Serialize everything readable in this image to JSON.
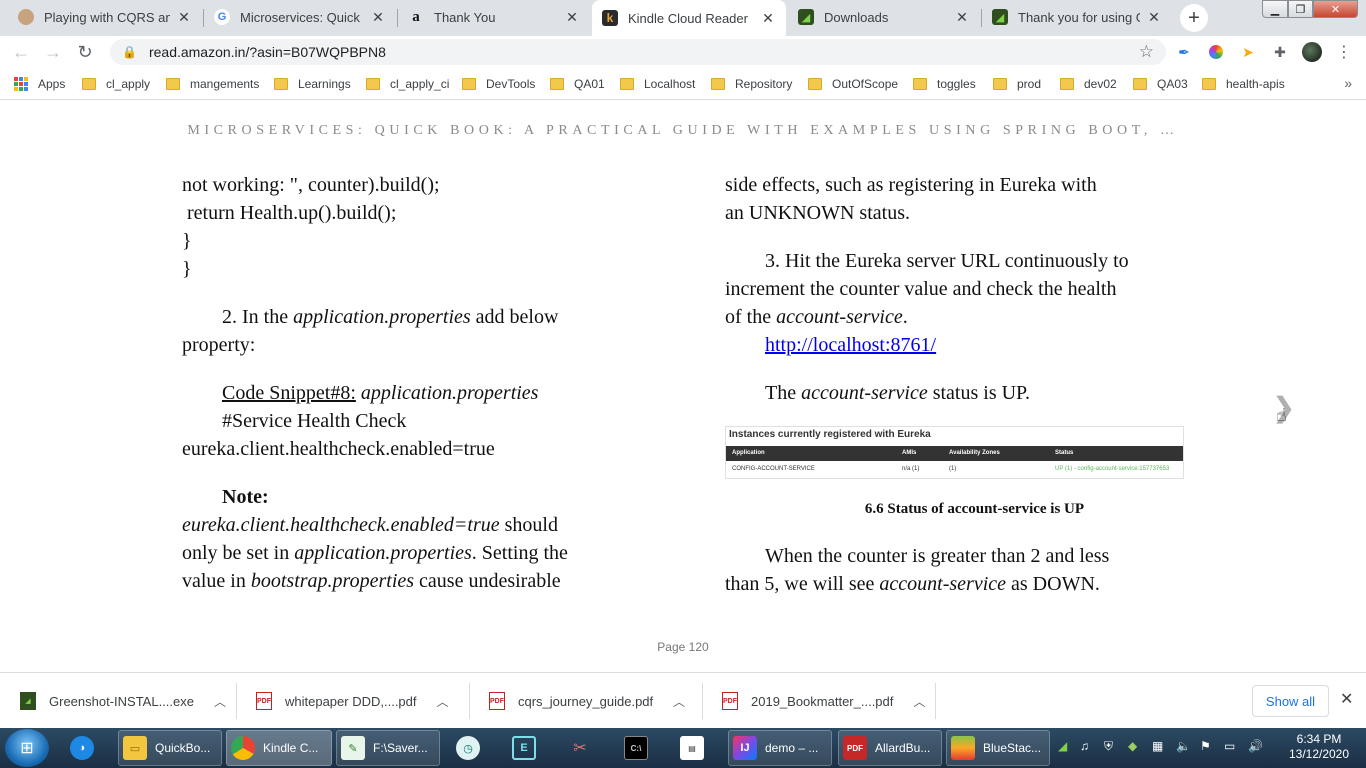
{
  "tabs": [
    {
      "title": "Playing with CQRS and E",
      "icon": "avatar-icon",
      "active": false
    },
    {
      "title": "Microservices: Quick Boo",
      "icon": "google-icon",
      "active": false
    },
    {
      "title": "Thank You",
      "icon": "amazon-icon",
      "active": false
    },
    {
      "title": "Kindle Cloud Reader",
      "icon": "kindle-icon",
      "active": true
    },
    {
      "title": "Downloads",
      "icon": "greenshot-icon",
      "active": false
    },
    {
      "title": "Thank you for using Gre",
      "icon": "greenshot-icon",
      "active": false
    }
  ],
  "address": {
    "url": "read.amazon.in/?asin=B07WQPBPN8"
  },
  "bookmarks": {
    "apps_label": "Apps",
    "items": [
      "cl_apply",
      "mangements",
      "Learnings",
      "cl_apply_ci",
      "DevTools",
      "QA01",
      "Localhost",
      "Repository",
      "OutOfScope",
      "toggles",
      "prod",
      "dev02",
      "QA03",
      "health-apis"
    ]
  },
  "book": {
    "header": "MICROSERVICES: QUICK BOOK: A PRACTICAL GUIDE WITH EXAMPLES USING SPRING BOOT, …",
    "left": {
      "l1": "not working: \", counter).build();",
      "l2": " return Health.up().build();",
      "l3": "}",
      "l4": "}",
      "p2_a": "2. In the ",
      "p2_em": "application.properties",
      "p2_b": " add below",
      "p2_c": "property:",
      "snippet_u": "Code Snippet#8:",
      "snippet_em": " application.properties",
      "snippet_comment": "#Service Health Check",
      "snippet_code": "eureka.client.healthcheck.enabled=true",
      "note_label": "Note:",
      "note_em1": "eureka.client.healthcheck.enabled=true",
      "note_t1": " should",
      "note_t2": "only be set in ",
      "note_em2": "application.properties",
      "note_t3": ". Setting the",
      "note_t4": "value in ",
      "note_em3": "bootstrap.properties",
      "note_t5": " cause undesirable"
    },
    "right": {
      "r1": "side effects, such as registering in Eureka with",
      "r2": "an UNKNOWN status.",
      "p3_a": "3. Hit the Eureka server URL continuously to",
      "p3_b": "increment the counter value and check the health",
      "p3_c": "of the ",
      "p3_em": "account-service",
      "p3_d": ".",
      "link": "http://localhost:8761/",
      "status_a": "The ",
      "status_em": "account-service",
      "status_b": " status is UP.",
      "caption": "6.6 Status of account-service is UP",
      "down_a": "When the counter is greater than 2 and less",
      "down_b": "than 5, we will see ",
      "down_em": "account-service",
      "down_c": " as DOWN."
    },
    "eureka": {
      "heading": "Instances currently registered with Eureka",
      "columns": [
        "Application",
        "AMIs",
        "Availability Zones",
        "Status"
      ],
      "row": [
        "CONFIG-ACCOUNT-SERVICE",
        "n/a (1)",
        "(1)",
        "UP (1) - config-account-service:157737653"
      ],
      "status_color": "#5cb85c"
    },
    "page": "Page 120"
  },
  "downloads": {
    "items": [
      {
        "name": "Greenshot-INSTAL....exe",
        "icon": "greenshot-icon"
      },
      {
        "name": "whitepaper DDD,....pdf",
        "icon": "pdf-icon"
      },
      {
        "name": "cqrs_journey_guide.pdf",
        "icon": "pdf-icon"
      },
      {
        "name": "2019_Bookmatter_....pdf",
        "icon": "pdf-icon"
      }
    ],
    "show_all": "Show all"
  },
  "taskbar": {
    "items": [
      {
        "label": "QuickBo...",
        "icon": "folder-icon"
      },
      {
        "label": "Kindle C...",
        "icon": "chrome-icon"
      },
      {
        "label": "F:\\Saver...",
        "icon": "editor-icon"
      },
      {
        "label": "demo – ...",
        "icon": "intellij-icon"
      },
      {
        "label": "AllardBu...",
        "icon": "pdf-icon"
      },
      {
        "label": "BlueStac...",
        "icon": "bluestacks-icon"
      }
    ],
    "time": "6:34 PM",
    "date": "13/12/2020"
  },
  "colors": {
    "link": "#0000ee",
    "tabstrip": "#dee1e6",
    "taskbar": "#1f3a54"
  }
}
